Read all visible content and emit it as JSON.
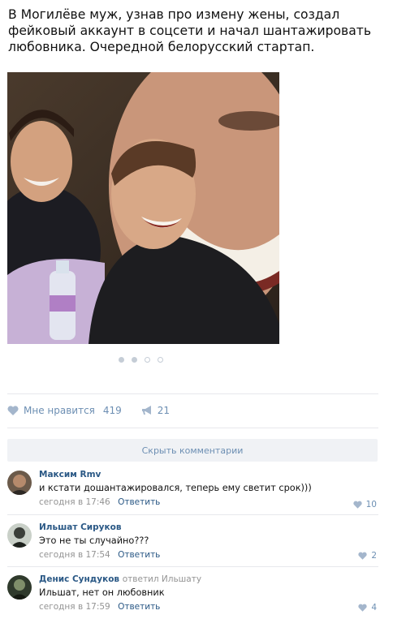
{
  "post": {
    "text": "В Могилёве муж, узнав про измену жены, создал фейковый аккаунт в соцсети и начал шантажировать любовника. Очередной белорусский стартап."
  },
  "carousel": {
    "count": 4,
    "active": 1
  },
  "actions": {
    "like_label": "Мне нравится",
    "like_count": "419",
    "share_count": "21"
  },
  "comments_toggle": "Скрыть комментарии",
  "comments": [
    {
      "author": "Максим Rmv",
      "reply_to": "",
      "text": "и кстати дошантажировался, теперь ему светит срок)))",
      "time": "сегодня в 17:46",
      "reply_label": "Ответить",
      "likes": "10"
    },
    {
      "author": "Ильшат Сируков",
      "reply_to": "",
      "text": "Это не ты случайно???",
      "time": "сегодня в 17:54",
      "reply_label": "Ответить",
      "likes": "2"
    },
    {
      "author": "Денис Сундуков",
      "reply_to": "ответил Ильшату",
      "text": "Ильшат, нет он любовник",
      "time": "сегодня в 17:59",
      "reply_label": "Ответить",
      "likes": "4"
    }
  ],
  "colors": {
    "link": "#2a5885",
    "action": "#6d8fb3",
    "meta": "#939393",
    "separator": "#e7e8ec",
    "toggle_bg": "#f0f2f5"
  }
}
